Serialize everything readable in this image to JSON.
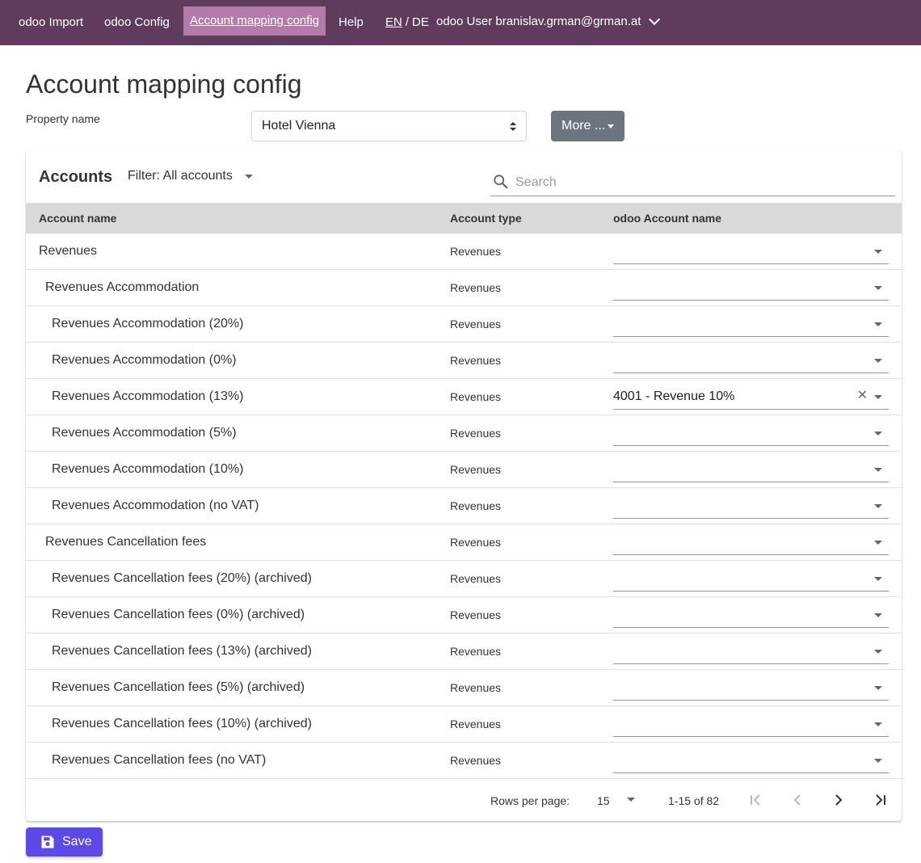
{
  "nav": {
    "items": [
      {
        "label": "odoo Import"
      },
      {
        "label": "odoo Config"
      },
      {
        "label": "Account mapping config"
      },
      {
        "label": "Help"
      }
    ],
    "lang_en": "EN",
    "lang_sep": "/",
    "lang_de": "DE",
    "user": "odoo User branislav.grman@grman.at"
  },
  "page": {
    "title": "Account mapping config",
    "property_label": "Property name",
    "property_value": "Hotel Vienna",
    "more_label": "More ..."
  },
  "card": {
    "title": "Accounts",
    "filter_label": "Filter: All accounts",
    "search_placeholder": "Search",
    "columns": [
      "Account name",
      "Account type",
      "odoo Account name"
    ],
    "rows": [
      {
        "name": "Revenues",
        "level": 0,
        "type": "Revenues",
        "mapping": ""
      },
      {
        "name": "Revenues Accommodation",
        "level": 1,
        "type": "Revenues",
        "mapping": ""
      },
      {
        "name": "Revenues Accommodation (20%)",
        "level": 2,
        "type": "Revenues",
        "mapping": ""
      },
      {
        "name": "Revenues Accommodation (0%)",
        "level": 2,
        "type": "Revenues",
        "mapping": ""
      },
      {
        "name": "Revenues Accommodation (13%)",
        "level": 2,
        "type": "Revenues",
        "mapping": "4001 - Revenue 10%"
      },
      {
        "name": "Revenues Accommodation (5%)",
        "level": 2,
        "type": "Revenues",
        "mapping": ""
      },
      {
        "name": "Revenues Accommodation (10%)",
        "level": 2,
        "type": "Revenues",
        "mapping": ""
      },
      {
        "name": "Revenues Accommodation (no VAT)",
        "level": 2,
        "type": "Revenues",
        "mapping": ""
      },
      {
        "name": "Revenues Cancellation fees",
        "level": 1,
        "type": "Revenues",
        "mapping": ""
      },
      {
        "name": "Revenues Cancellation fees (20%) (archived)",
        "level": 2,
        "type": "Revenues",
        "mapping": ""
      },
      {
        "name": "Revenues Cancellation fees (0%) (archived)",
        "level": 2,
        "type": "Revenues",
        "mapping": ""
      },
      {
        "name": "Revenues Cancellation fees (13%) (archived)",
        "level": 2,
        "type": "Revenues",
        "mapping": ""
      },
      {
        "name": "Revenues Cancellation fees (5%) (archived)",
        "level": 2,
        "type": "Revenues",
        "mapping": ""
      },
      {
        "name": "Revenues Cancellation fees (10%) (archived)",
        "level": 2,
        "type": "Revenues",
        "mapping": ""
      },
      {
        "name": "Revenues Cancellation fees (no VAT)",
        "level": 2,
        "type": "Revenues",
        "mapping": ""
      }
    ],
    "footer": {
      "rows_per_page_label": "Rows per page:",
      "rows_per_page_value": "15",
      "range": "1-15 of 82"
    }
  },
  "save_label": "Save",
  "colors": {
    "navbar": "#5f3b5c",
    "nav_active": "#b27ba9",
    "save_button": "#5d49e5",
    "more_button": "#6c757d",
    "table_header": "#d9d9d9"
  },
  "icons": {
    "user_menu": "chevron-down-icon",
    "select": "updown-arrows-icon",
    "search": "search-icon",
    "dropdown": "caret-down-icon",
    "clear": "close-icon",
    "first_page": "first-page-icon",
    "prev_page": "chevron-left-icon",
    "next_page": "chevron-right-icon",
    "last_page": "last-page-icon",
    "save": "floppy-disk-icon"
  }
}
